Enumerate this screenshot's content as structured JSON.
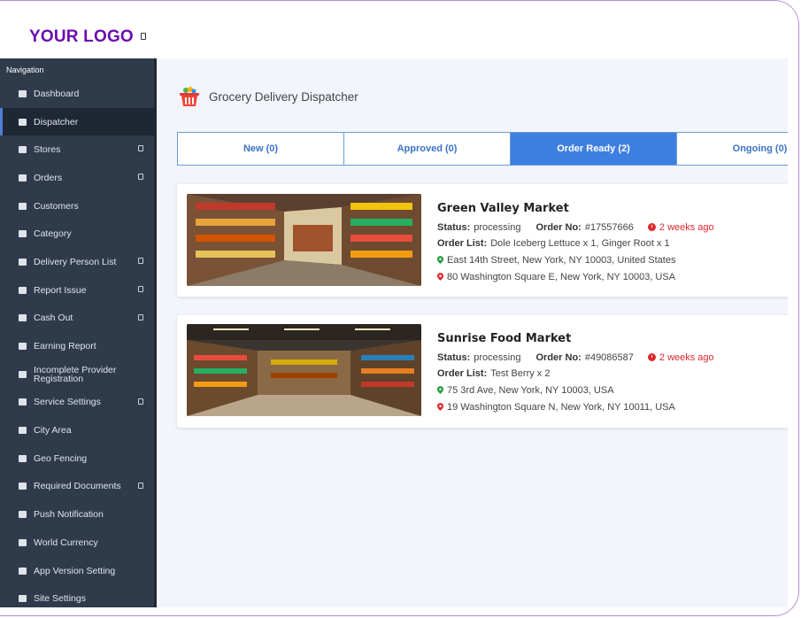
{
  "header": {
    "logo_text": "YOUR LOGO"
  },
  "sidebar": {
    "heading": "Navigation",
    "items": [
      {
        "label": "Dashboard",
        "icon": "home-icon"
      },
      {
        "label": "Dispatcher",
        "icon": "list-icon",
        "active": true
      },
      {
        "label": "Stores",
        "icon": "store-icon"
      },
      {
        "label": "Orders",
        "icon": "bag-icon"
      },
      {
        "label": "Customers",
        "icon": "users-icon"
      },
      {
        "label": "Category",
        "icon": "menu-icon"
      },
      {
        "label": "Delivery Person List",
        "icon": "motorbike-icon"
      },
      {
        "label": "Report Issue",
        "icon": "file-icon"
      },
      {
        "label": "Cash Out",
        "icon": "cash-icon"
      },
      {
        "label": "Earning Report",
        "icon": "report-icon"
      },
      {
        "label": "Incomplete Provider Registration",
        "icon": "user-x-icon"
      },
      {
        "label": "Service Settings",
        "icon": "gear-icon"
      },
      {
        "label": "City Area",
        "icon": "building-icon"
      },
      {
        "label": "Geo Fencing",
        "icon": "chart-icon"
      },
      {
        "label": "Required Documents",
        "icon": "document-icon"
      },
      {
        "label": "Push Notification",
        "icon": "bell-icon"
      },
      {
        "label": "World Currency",
        "icon": "money-icon"
      },
      {
        "label": "App Version Setting",
        "icon": "tools-icon"
      },
      {
        "label": "Site Settings",
        "icon": "settings-icon"
      }
    ]
  },
  "main": {
    "title": "Grocery Delivery Dispatcher",
    "tabs": [
      {
        "label": "New (0)"
      },
      {
        "label": "Approved (0)"
      },
      {
        "label": "Order Ready (2)",
        "active": true
      },
      {
        "label": "Ongoing (0)"
      }
    ],
    "orders": [
      {
        "store_name": "Green Valley Market",
        "status_label": "Status:",
        "status": "processing",
        "order_no_label": "Order No:",
        "order_no": "#17557666",
        "time_ago": "2 weeks ago",
        "order_list_label": "Order List:",
        "order_list": "Dole Iceberg Lettuce x 1, Ginger Root x 1",
        "pickup_address": "East 14th Street, New York, NY 10003, United States",
        "dropoff_address": "80 Washington Square E, New York, NY 10003, USA"
      },
      {
        "store_name": "Sunrise Food Market",
        "status_label": "Status:",
        "status": "processing",
        "order_no_label": "Order No:",
        "order_no": "#49086587",
        "time_ago": "2 weeks ago",
        "order_list_label": "Order List:",
        "order_list": "Test Berry x 2",
        "pickup_address": "75 3rd Ave, New York, NY 10003, USA",
        "dropoff_address": "19 Washington Square N, New York, NY 10011, USA"
      }
    ]
  },
  "colors": {
    "brand": "#6a0dad",
    "sidebar_bg": "#2f3b4b",
    "tab_active": "#3d7fe0",
    "time_ago": "#e0282e",
    "pickup_pin": "#1e9e3a",
    "dropoff_pin": "#e0282e"
  }
}
